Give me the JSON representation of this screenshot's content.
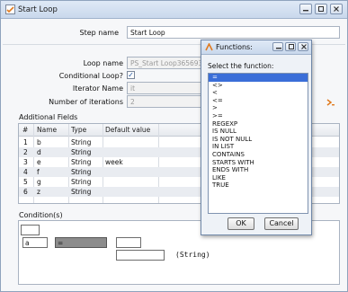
{
  "window": {
    "title": "Start Loop"
  },
  "form": {
    "step_name_label": "Step name",
    "step_name_value": "Start Loop",
    "loop_name_label": "Loop name",
    "loop_name_value": "PS_Start Loop365693651",
    "conditional_loop_label": "Conditional Loop?",
    "conditional_loop_checked": true,
    "iterator_name_label": "Iterator Name",
    "iterator_name_value": "it",
    "iterations_label": "Number of iterations",
    "iterations_value": "2"
  },
  "fields": {
    "section_label": "Additional Fields",
    "columns": [
      "#",
      "Name",
      "Type",
      "Default value"
    ],
    "rows": [
      {
        "num": "1",
        "name": "b",
        "type": "String",
        "default": ""
      },
      {
        "num": "2",
        "name": "d",
        "type": "String",
        "default": ""
      },
      {
        "num": "3",
        "name": "e",
        "type": "String",
        "default": "week"
      },
      {
        "num": "4",
        "name": "f",
        "type": "String",
        "default": ""
      },
      {
        "num": "5",
        "name": "g",
        "type": "String",
        "default": ""
      },
      {
        "num": "6",
        "name": "z",
        "type": "String",
        "default": ""
      }
    ]
  },
  "condition": {
    "section_label": "Condition(s)",
    "field_value": "a",
    "function_value": "=",
    "type_label": "(String)"
  },
  "functions_dialog": {
    "title": "Functions:",
    "prompt": "Select the function:",
    "options": [
      "=",
      "<>",
      "<",
      "<=",
      ">",
      ">=",
      "REGEXP",
      "IS NULL",
      "IS NOT NULL",
      "IN LIST",
      "CONTAINS",
      "STARTS WITH",
      "ENDS WITH",
      "LIKE",
      "TRUE"
    ],
    "selected": "=",
    "ok_label": "OK",
    "cancel_label": "Cancel"
  },
  "colors": {
    "selection": "#3a6ed8",
    "title_bar": "#c9d8ec",
    "icon_accent": "#e07a1f"
  }
}
